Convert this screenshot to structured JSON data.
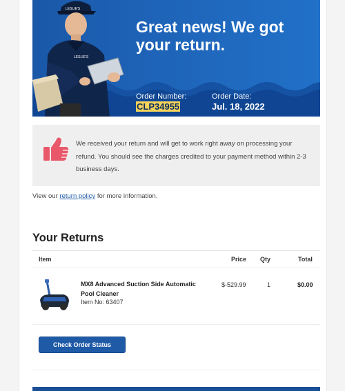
{
  "hero": {
    "title_line1": "Great news! We got",
    "title_line2": "your return.",
    "order_number_label": "Order Number:",
    "order_number": "CLP34955",
    "order_date_label": "Order Date:",
    "order_date": "Jul. 18, 2022",
    "cap_logo_text": "LESLIE'S",
    "shirt_logo_text": "LESLIE'S"
  },
  "message": {
    "icon": "thumbs-up-icon",
    "text": "We received your return and will get to work right away on processing your refund. You should see the charges credited to your payment method within 2-3 business days."
  },
  "policy": {
    "prefix": "View our ",
    "link": "return policy",
    "suffix": " for more information."
  },
  "returns": {
    "heading": "Your Returns",
    "columns": {
      "item": "Item",
      "price": "Price",
      "qty": "Qty",
      "total": "Total"
    },
    "items": [
      {
        "name": "MX8 Advanced Suction Side Automatic Pool Cleaner",
        "item_no": "Item No: 63407",
        "price": "$-529.99",
        "qty": "1",
        "total": "$0.00"
      }
    ]
  },
  "actions": {
    "check_status": "Check Order Status"
  },
  "colors": {
    "brand_blue": "#1f5aa6",
    "highlight": "#f6d35b",
    "thumb_icon": "#e8586a"
  }
}
